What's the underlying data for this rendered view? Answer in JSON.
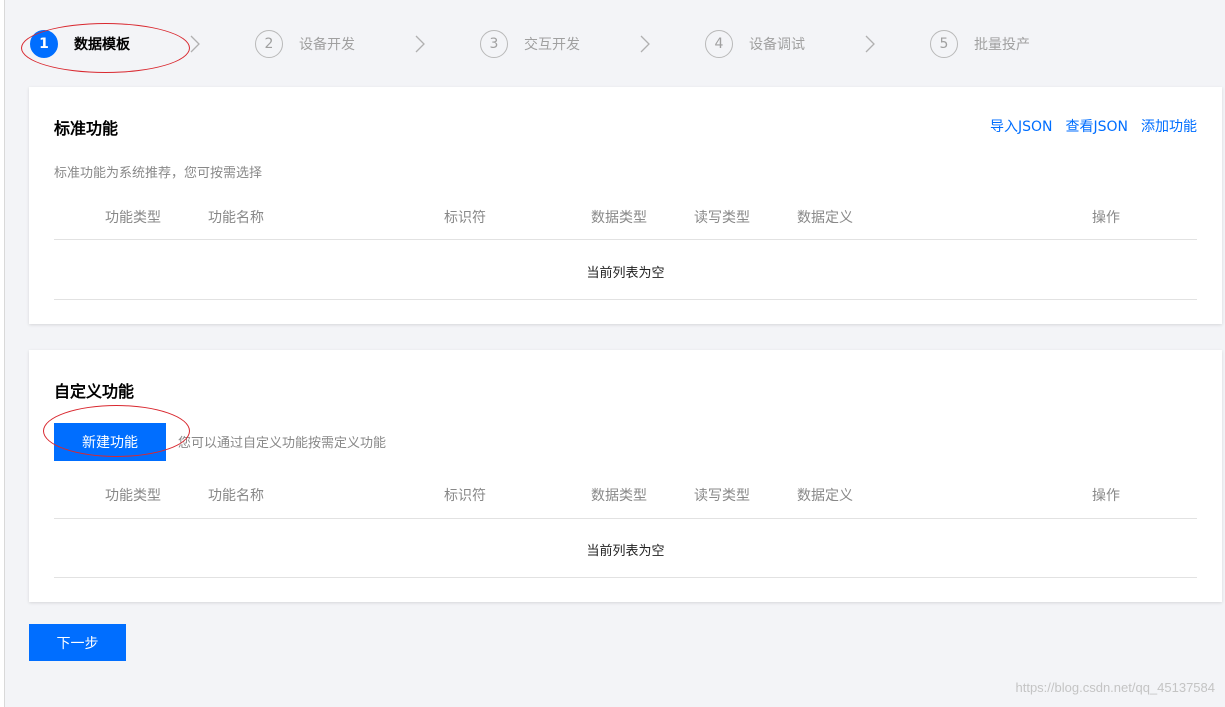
{
  "steps": [
    {
      "num": "1",
      "label": "数据模板",
      "active": true
    },
    {
      "num": "2",
      "label": "设备开发",
      "active": false
    },
    {
      "num": "3",
      "label": "交互开发",
      "active": false
    },
    {
      "num": "4",
      "label": "设备调试",
      "active": false
    },
    {
      "num": "5",
      "label": "批量投产",
      "active": false
    }
  ],
  "standard": {
    "title": "标准功能",
    "description": "标准功能为系统推荐，您可按需选择",
    "links": [
      "导入JSON",
      "查看JSON",
      "添加功能"
    ],
    "columns": [
      "功能类型",
      "功能名称",
      "标识符",
      "数据类型",
      "读写类型",
      "数据定义",
      "操作"
    ],
    "empty_text": "当前列表为空"
  },
  "custom": {
    "title": "自定义功能",
    "new_button": "新建功能",
    "hint": "您可以通过自定义功能按需定义功能",
    "columns": [
      "功能类型",
      "功能名称",
      "标识符",
      "数据类型",
      "读写类型",
      "数据定义",
      "操作"
    ],
    "empty_text": "当前列表为空"
  },
  "next_button": "下一步",
  "watermark": "https://blog.csdn.net/qq_45137584",
  "colors": {
    "primary": "#006eff",
    "annotation": "#d9282f",
    "background": "#f3f4f7"
  }
}
